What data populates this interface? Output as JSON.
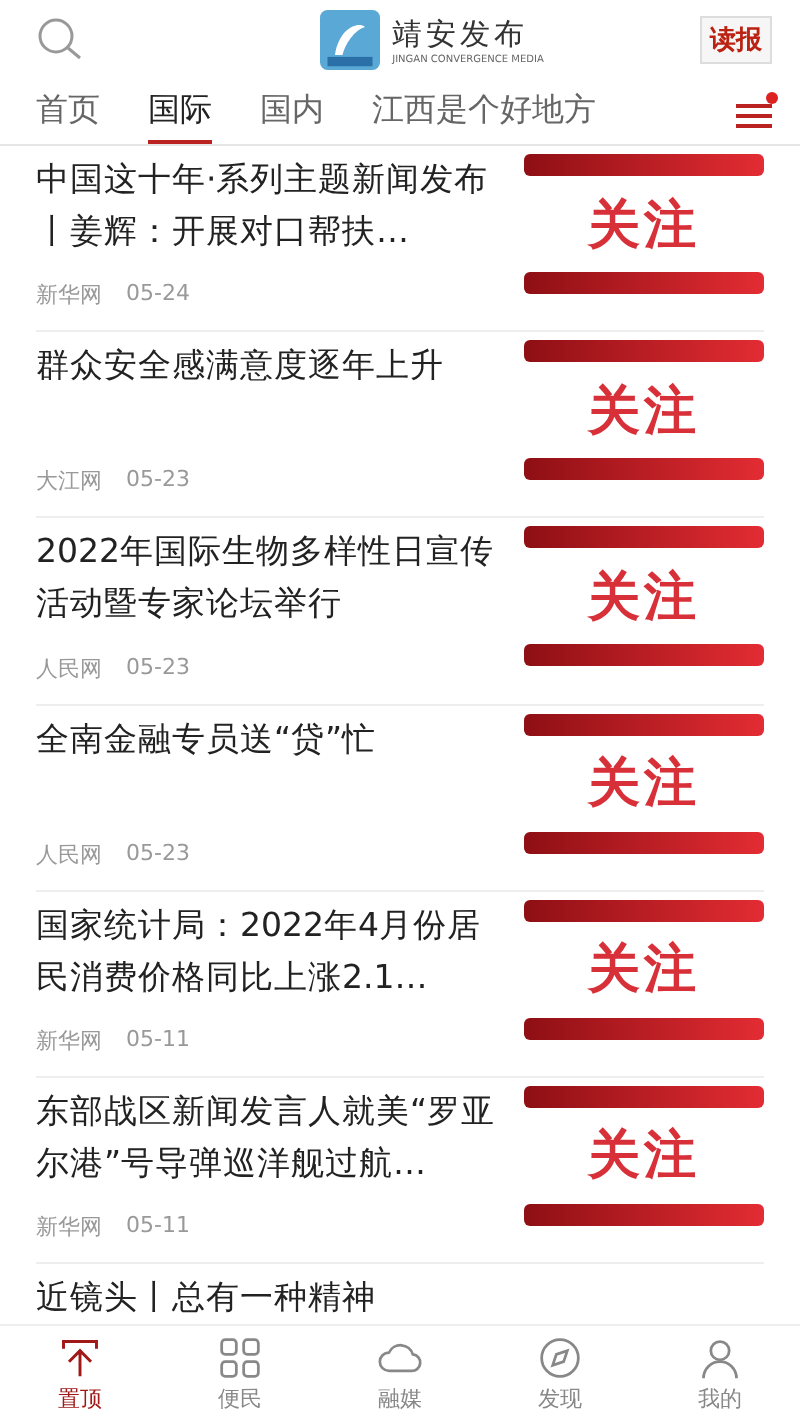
{
  "header": {
    "title": "靖安发布",
    "subtitle": "JINGAN CONVERGENCE MEDIA",
    "read_button": "读报"
  },
  "tabs": [
    {
      "label": "首页",
      "selected": false
    },
    {
      "label": "国际",
      "selected": true
    },
    {
      "label": "国内",
      "selected": false
    },
    {
      "label": "江西是个好地方",
      "selected": false
    }
  ],
  "menu": {
    "badge": true
  },
  "articles": [
    {
      "title": "中国这十年·系列主题新闻发布丨姜辉：开展对口帮扶…",
      "source": "新华网",
      "date": "05-24",
      "thumb_text": "关注"
    },
    {
      "title": "群众安全感满意度逐年上升",
      "source": "大江网",
      "date": "05-23",
      "thumb_text": "关注"
    },
    {
      "title": "2022年国际生物多样性日宣传活动暨专家论坛举行",
      "source": "人民网",
      "date": "05-23",
      "thumb_text": "关注"
    },
    {
      "title": "全南金融专员送“贷”忙",
      "source": "人民网",
      "date": "05-23",
      "thumb_text": "关注"
    },
    {
      "title": "国家统计局：2022年4月份居民消费价格同比上涨2.1…",
      "source": "新华网",
      "date": "05-11",
      "thumb_text": "关注"
    },
    {
      "title": "东部战区新闻发言人就美“罗亚尔港”号导弹巡洋舰过航…",
      "source": "新华网",
      "date": "05-11",
      "thumb_text": "关注"
    }
  ],
  "partial_article": {
    "title": "近镜头丨总有一种精神"
  },
  "bottom_nav": [
    {
      "label": "置顶",
      "kind": "top",
      "selected": true
    },
    {
      "label": "便民",
      "kind": "grid",
      "selected": false
    },
    {
      "label": "融媒",
      "kind": "cloud",
      "selected": false
    },
    {
      "label": "发现",
      "kind": "compass",
      "selected": false
    },
    {
      "label": "我的",
      "kind": "person",
      "selected": false
    }
  ]
}
